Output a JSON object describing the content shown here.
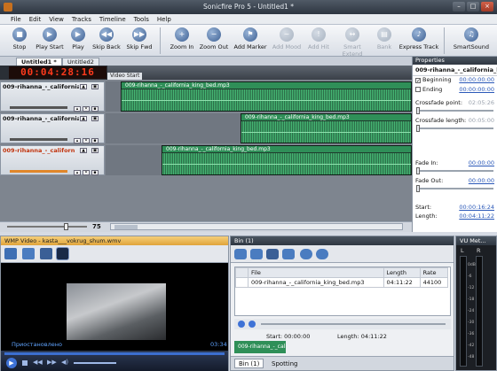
{
  "window": {
    "title": "Sonicfire Pro 5 - Untitled1 *"
  },
  "menu": [
    "File",
    "Edit",
    "View",
    "Tracks",
    "Timeline",
    "Tools",
    "Help"
  ],
  "toolbar": [
    {
      "label": "Stop",
      "icon": "stop-icon",
      "enabled": true
    },
    {
      "label": "Play Start",
      "icon": "play-start-icon",
      "enabled": true
    },
    {
      "label": "Play",
      "icon": "play-icon",
      "enabled": true
    },
    {
      "label": "Skip Back",
      "icon": "skip-back-icon",
      "enabled": true
    },
    {
      "label": "Skip Fwd",
      "icon": "skip-forward-icon",
      "enabled": true
    },
    {
      "label": "Zoom In",
      "icon": "zoom-in-icon",
      "enabled": true
    },
    {
      "label": "Zoom Out",
      "icon": "zoom-out-icon",
      "enabled": true
    },
    {
      "label": "Add Marker",
      "icon": "marker-icon",
      "enabled": true
    },
    {
      "label": "Add Mood",
      "icon": "mood-icon",
      "enabled": false
    },
    {
      "label": "Add Hit",
      "icon": "hit-icon",
      "enabled": false
    },
    {
      "label": "Smart Extend",
      "icon": "extend-icon",
      "enabled": false
    },
    {
      "label": "Bank",
      "icon": "bank-icon",
      "enabled": false
    },
    {
      "label": "Express Track",
      "icon": "express-track-icon",
      "enabled": true
    },
    {
      "label": "SmartSound",
      "icon": "smartsound-icon",
      "enabled": true
    }
  ],
  "tabs": [
    "Untitled1 *",
    "Untitled2"
  ],
  "timecode": "00:04:28:16",
  "video_start_label": "Video Start",
  "tracks": [
    {
      "name": "009-rihanna_-_california_king_",
      "clip": "009-rihanna_-_california_king_bed.mp3",
      "selected": false
    },
    {
      "name": "009-rihanna_-_california_king_",
      "clip": "009-rihanna_-_california_king_bed.mp3",
      "selected": false
    },
    {
      "name": "009-rihanna_-_californ",
      "clip": "009-rihanna_-_california_king_bed.mp3",
      "selected": true
    }
  ],
  "zoom_value": "75",
  "properties": {
    "header": "Properties",
    "filename": "009-rihanna_-_california_king_bed",
    "beginning_label": "Beginning",
    "beginning_value": "00:00:00:00",
    "beginning_checked": true,
    "ending_label": "Ending",
    "ending_value": "00:00:00:00",
    "crossfade_point_label": "Crossfade point:",
    "crossfade_point_value": "02:05:26",
    "crossfade_length_label": "Crossfade length:",
    "crossfade_length_value": "00:05:00",
    "fade_in_label": "Fade In:",
    "fade_in_value": "00:00:00",
    "fade_out_label": "Fade Out:",
    "fade_out_value": "00:00:00",
    "start_label": "Start:",
    "start_value": "00:00:16:24",
    "length_label": "Length:",
    "length_value": "00:04:11:22"
  },
  "video_panel": {
    "title": "WMP Video - kasta___vokrug_shum.wmv",
    "status": "Приостановлено",
    "time": "03:34"
  },
  "bin": {
    "title": "Bin (1)",
    "columns": [
      "File",
      "Length",
      "Rate"
    ],
    "rows": [
      {
        "file": "009-rihanna_-_california_king_bed.mp3",
        "length": "04:11:22",
        "rate": "44100"
      }
    ],
    "start_label": "Start:",
    "start_value": "00:00:00",
    "length_label": "Length:",
    "length_value": "04:11:22",
    "clip_label": "009-rihanna_-_califc",
    "tabs": [
      "Bin (1)",
      "Spotting"
    ]
  },
  "vu": {
    "title": "VU Met...",
    "channels": [
      "L",
      "R"
    ],
    "scale": [
      "0dB",
      "-6",
      "-12",
      "-18",
      "-24",
      "-30",
      "-36",
      "-42",
      "-48"
    ]
  },
  "colors": {
    "accent_red": "#ff3a1c",
    "clip_green": "#2f8f58",
    "link_blue": "#2a58b8"
  }
}
